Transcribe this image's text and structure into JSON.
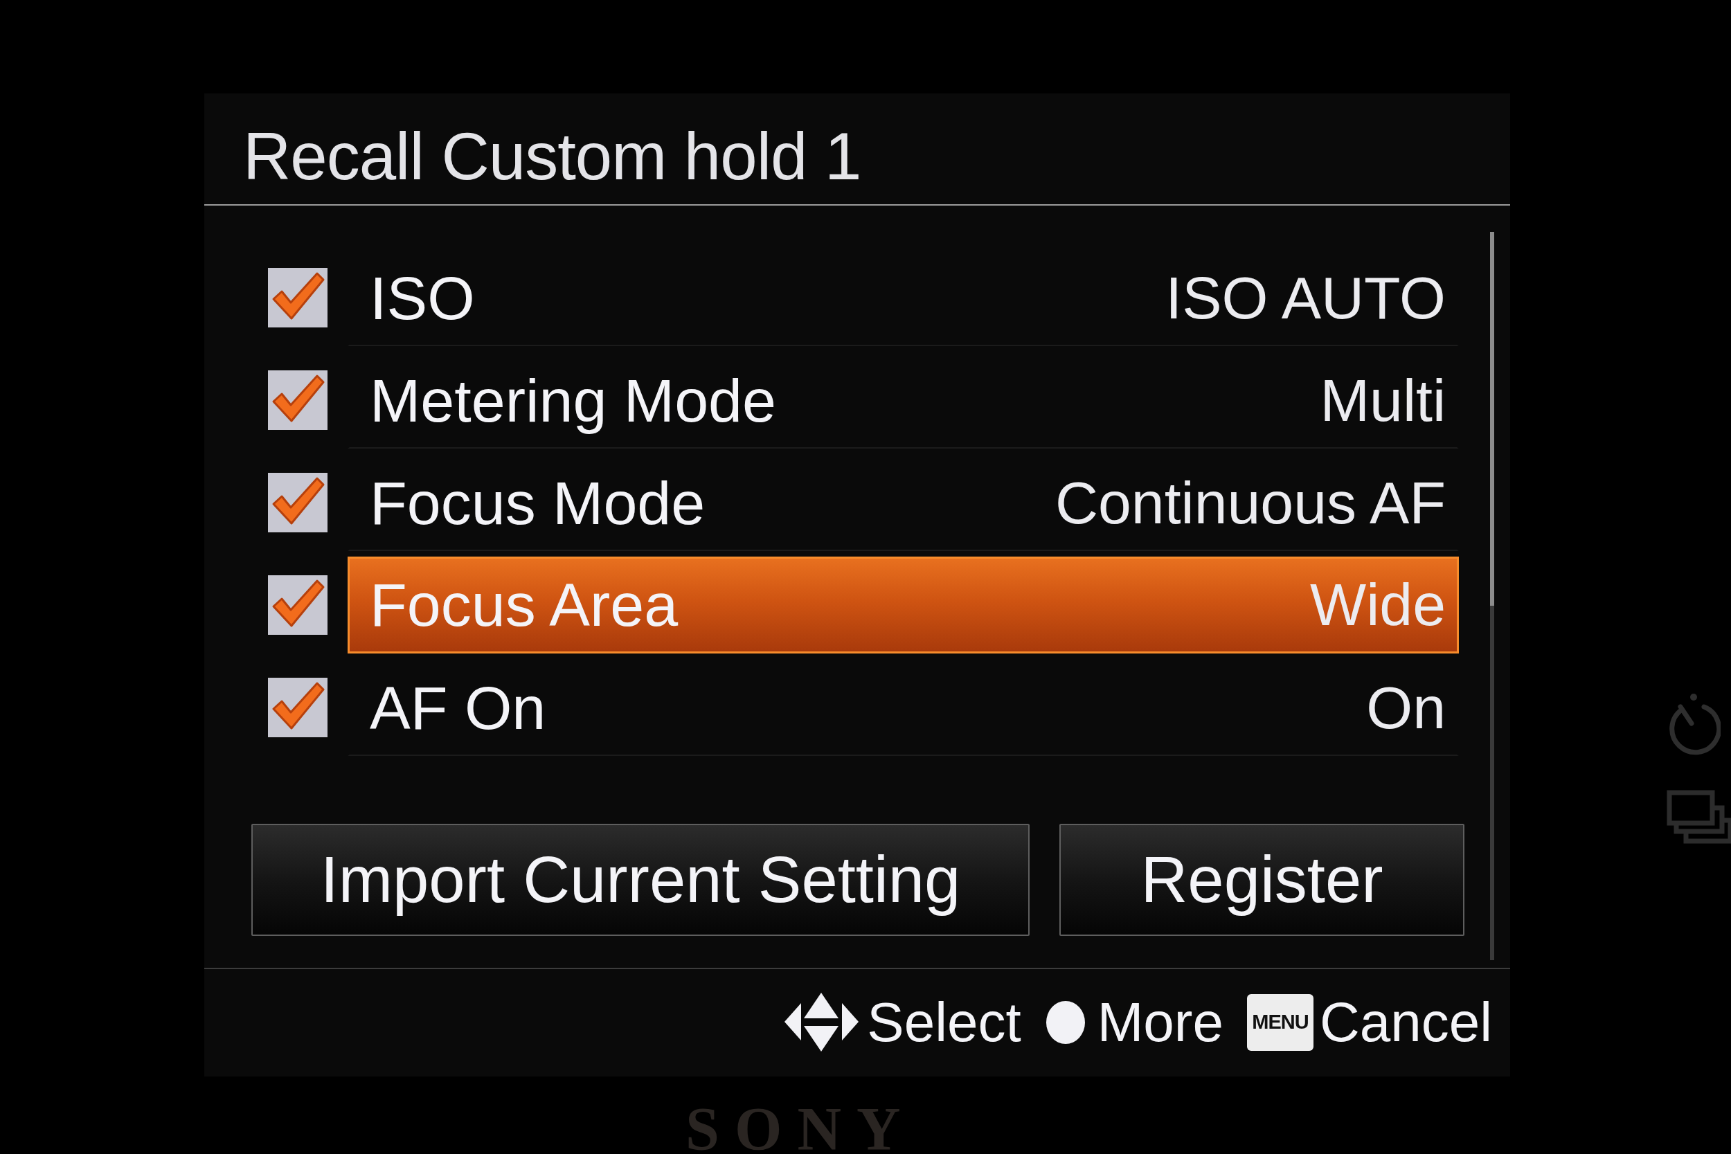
{
  "screen": {
    "title": "Recall Custom hold 1",
    "items": [
      {
        "label": "ISO",
        "value": "ISO AUTO",
        "checked": true,
        "selected": false
      },
      {
        "label": "Metering Mode",
        "value": "Multi",
        "checked": true,
        "selected": false
      },
      {
        "label": "Focus Mode",
        "value": "Continuous AF",
        "checked": true,
        "selected": false
      },
      {
        "label": "Focus Area",
        "value": "Wide",
        "checked": true,
        "selected": true
      },
      {
        "label": "AF On",
        "value": "On",
        "checked": true,
        "selected": false
      }
    ],
    "buttons": [
      "Import Current Setting",
      "Register"
    ],
    "footer_hints": [
      {
        "kind": "arrows",
        "label": "Select"
      },
      {
        "kind": "dot",
        "label": "More"
      },
      {
        "kind": "key",
        "key_label": "MENU",
        "label": "Cancel"
      }
    ]
  },
  "camera_body": {
    "logo": "SONY"
  }
}
